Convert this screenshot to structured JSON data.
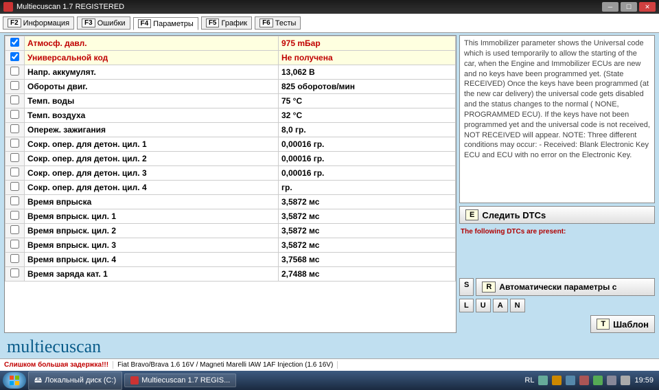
{
  "window": {
    "title": "Multiecuscan 1.7 REGISTERED"
  },
  "tabs": [
    {
      "fkey": "F2",
      "label": "Информация"
    },
    {
      "fkey": "F3",
      "label": "Ошибки"
    },
    {
      "fkey": "F4",
      "label": "Параметры"
    },
    {
      "fkey": "F5",
      "label": "График"
    },
    {
      "fkey": "F6",
      "label": "Тесты"
    }
  ],
  "active_tab": 2,
  "params": [
    {
      "name": "Атмосф. давл.",
      "value": "975 mБар",
      "checked": true,
      "highlight": true
    },
    {
      "name": "Универсальной код",
      "value": "Не получена",
      "checked": true,
      "highlight": true
    },
    {
      "name": "Напр. аккумулят.",
      "value": "13,062 В",
      "checked": false,
      "highlight": false
    },
    {
      "name": "Обороты двиг.",
      "value": "825 оборотов/мин",
      "checked": false,
      "highlight": false
    },
    {
      "name": "Темп. воды",
      "value": "75 °C",
      "checked": false,
      "highlight": false
    },
    {
      "name": "Темп. воздуха",
      "value": "32 °C",
      "checked": false,
      "highlight": false
    },
    {
      "name": "Опереж. зажигания",
      "value": "8,0 гр.",
      "checked": false,
      "highlight": false
    },
    {
      "name": "Сокр. опер. для детон. цил. 1",
      "value": "0,00016 гр.",
      "checked": false,
      "highlight": false
    },
    {
      "name": "Сокр. опер. для детон. цил. 2",
      "value": "0,00016 гр.",
      "checked": false,
      "highlight": false
    },
    {
      "name": "Сокр. опер. для детон. цил. 3",
      "value": "0,00016 гр.",
      "checked": false,
      "highlight": false
    },
    {
      "name": "Сокр. опер. для детон. цил. 4",
      "value": " гр.",
      "checked": false,
      "highlight": false
    },
    {
      "name": "Время впрыска",
      "value": "3,5872 мс",
      "checked": false,
      "highlight": false
    },
    {
      "name": "Время впрыск. цил. 1",
      "value": "3,5872 мс",
      "checked": false,
      "highlight": false
    },
    {
      "name": "Время впрыск. цил. 2",
      "value": "3,5872 мс",
      "checked": false,
      "highlight": false
    },
    {
      "name": "Время впрыск. цил. 3",
      "value": "3,5872 мс",
      "checked": false,
      "highlight": false
    },
    {
      "name": "Время впрыск. цил. 4",
      "value": "3,7568 мс",
      "checked": false,
      "highlight": false
    },
    {
      "name": "Время заряда кат. 1",
      "value": "2,7488 мс",
      "checked": false,
      "highlight": false
    }
  ],
  "info_text": "This Immobilizer parameter shows the Universal code which is used temporarily to allow the starting of the car, when the Engine and Immobilizer ECUs are new and no keys have been programmed yet. (State RECEIVED)\nOnce the keys have been programmed (at the new car delivery) the universal code gets disabled and the status changes to the normal ( NONE,  PROGRAMMED ECU). If the keys have not been programmed yet and the universal code is not received, NOT RECEIVED will appear. NOTE: Three different conditions may occur:\n- Received: Blank Electronic Key ECU and ECU with no error on the Electronic Key.",
  "follow_dtc": {
    "key": "E",
    "label": "Следить DTCs"
  },
  "dtc_notice": "The following DTCs are present:",
  "auto_row": {
    "s": "S",
    "r": "R",
    "label": "Автоматически параметры с"
  },
  "luan": [
    "L",
    "U",
    "A",
    "N"
  ],
  "template": {
    "key": "T",
    "label": "Шаблон"
  },
  "brand": "multiecuscan",
  "status": {
    "warn": "Слишком большая задержка!!!",
    "vehicle": "Fiat Bravo/Brava 1.6 16V / Magneti Marelli IAW 1AF Injection (1.6 16V)"
  },
  "taskbar": {
    "btn1": "Локальный диск (C:)",
    "btn2": "Multiecuscan 1.7 REGIS...",
    "lang": "RL",
    "time": "19:59"
  }
}
